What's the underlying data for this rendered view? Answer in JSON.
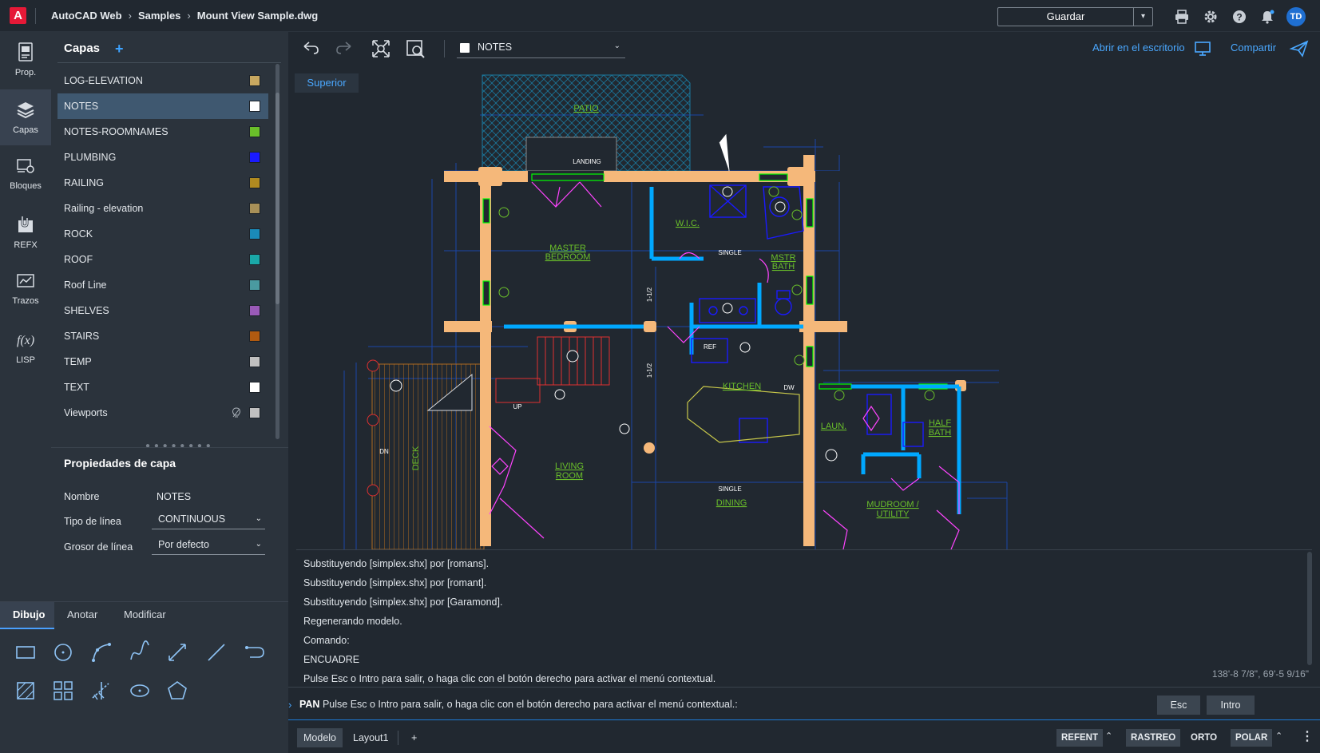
{
  "app": {
    "logo_letter": "A",
    "breadcrumbs": [
      "AutoCAD Web",
      "Samples",
      "Mount View Sample.dwg"
    ]
  },
  "topbar": {
    "save_label": "Guardar",
    "user_initials": "TD"
  },
  "rail": [
    {
      "label": "Prop.",
      "icon": "properties-icon"
    },
    {
      "label": "Capas",
      "icon": "layers-icon"
    },
    {
      "label": "Bloques",
      "icon": "blocks-icon"
    },
    {
      "label": "REFX",
      "icon": "xref-icon"
    },
    {
      "label": "Trazos",
      "icon": "traces-icon"
    },
    {
      "label": "LISP",
      "icon": "lisp-icon"
    }
  ],
  "layers": {
    "title": "Capas",
    "add_symbol": "+",
    "items": [
      {
        "name": "LOG-ELEVATION",
        "color": "#c8a860"
      },
      {
        "name": "NOTES",
        "color": "#ffffff"
      },
      {
        "name": "NOTES-ROOMNAMES",
        "color": "#6abf2a"
      },
      {
        "name": "PLUMBING",
        "color": "#1a1aff"
      },
      {
        "name": "RAILING",
        "color": "#b08a20"
      },
      {
        "name": "Railing - elevation",
        "color": "#a89058"
      },
      {
        "name": "ROCK",
        "color": "#1a8ab8"
      },
      {
        "name": "ROOF",
        "color": "#1aa8a8"
      },
      {
        "name": "Roof Line",
        "color": "#4a9aa0"
      },
      {
        "name": "SHELVES",
        "color": "#9a5ab8"
      },
      {
        "name": "STAIRS",
        "color": "#b05a10"
      },
      {
        "name": "TEMP",
        "color": "#c0c0c0"
      },
      {
        "name": "TEXT",
        "color": "#ffffff"
      },
      {
        "name": "Viewports",
        "color": "#c0c0c0"
      }
    ],
    "selected": "NOTES"
  },
  "layer_props": {
    "title": "Propiedades de capa",
    "name_label": "Nombre",
    "name_value": "NOTES",
    "linetype_label": "Tipo de línea",
    "linetype_value": "CONTINUOUS",
    "lineweight_label": "Grosor de línea",
    "lineweight_value": "Por defecto"
  },
  "tools": {
    "tabs": [
      "Dibujo",
      "Anotar",
      "Modificar"
    ],
    "active_tab": "Dibujo"
  },
  "canvas": {
    "current_layer": "NOTES",
    "open_desktop": "Abrir en el escritorio",
    "share": "Compartir",
    "view_label": "Superior"
  },
  "drawing_labels": {
    "patio": "PATIO",
    "landing": "LANDING",
    "master_bedroom_1": "MASTER",
    "master_bedroom_2": "BEDROOM",
    "single": "SINGLE",
    "wic": "W.I.C.",
    "mstr_bath_1": "MSTR",
    "mstr_bath_2": "BATH",
    "kitchen": "KITCHEN",
    "ref": "REF",
    "dw": "DW",
    "laun": "LAUN.",
    "half_bath_1": "HALF",
    "half_bath_2": "BATH",
    "living_1": "LIVING",
    "living_2": "ROOM",
    "dining": "DINING",
    "mudroom_1": "MUDROOM /",
    "mudroom_2": "UTILITY",
    "deck": "DECK",
    "up": "UP",
    "dn": "DN",
    "dim_1": "1-1/2",
    "dim_2": "1-1/2"
  },
  "command_history": [
    "Substituyendo [simplex.shx] por [romans].",
    "Substituyendo [simplex.shx] por [romant].",
    "Substituyendo [simplex.shx] por [Garamond].",
    "Regenerando modelo.",
    "Comando:",
    "ENCUADRE",
    "Pulse Esc o Intro para salir, o haga clic con el botón derecho para activar el menú contextual."
  ],
  "coordinates": "138'-8 7/8\", 69'-5 9/16\"",
  "command_line": {
    "keyword": "PAN",
    "prompt": "Pulse Esc o Intro para salir, o haga clic con el botón derecho para activar el menú contextual.:",
    "esc_label": "Esc",
    "enter_label": "Intro"
  },
  "status": {
    "tabs": [
      "Modelo",
      "Layout1"
    ],
    "add_tab": "+",
    "toggles": [
      "REFENT",
      "RASTREO",
      "ORTO",
      "POLAR"
    ]
  },
  "colors": {
    "accent": "#4aa8ff",
    "wall": "#f5b87a",
    "room_text": "#6abf2a",
    "window": "#00ff00",
    "door": "#ff44ff",
    "plumbing": "#00a8ff"
  }
}
